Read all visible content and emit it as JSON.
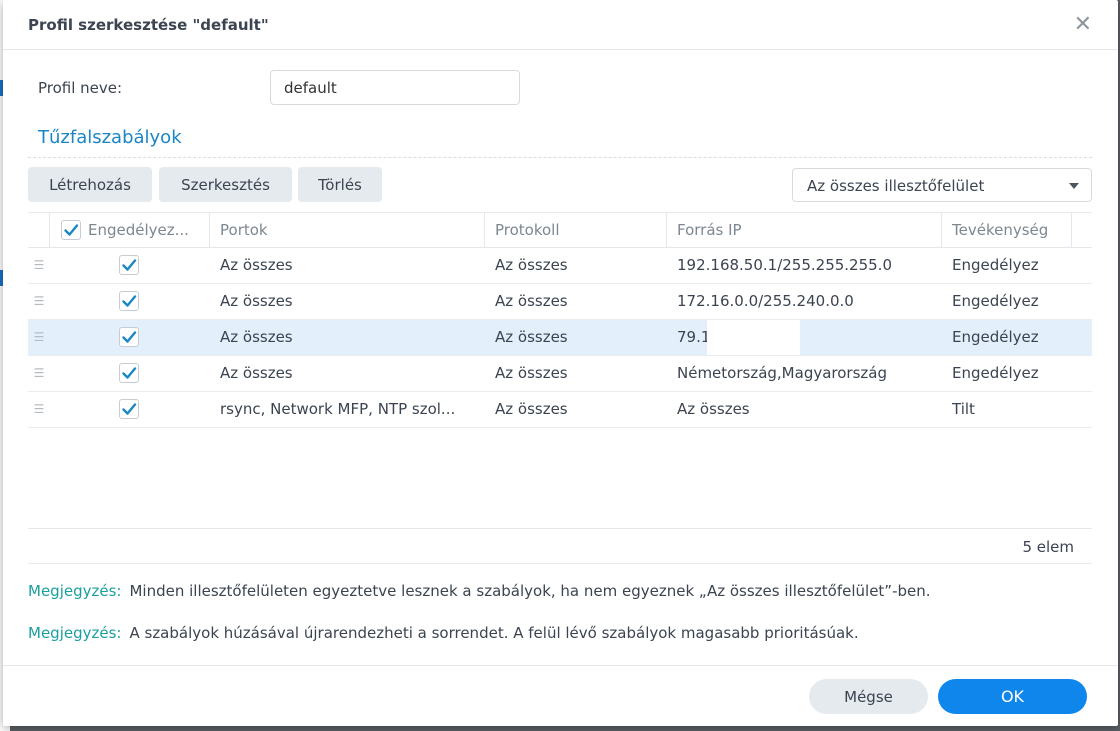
{
  "dialog": {
    "title": "Profil szerkesztése \"default\"",
    "close_icon": "close-icon"
  },
  "profile": {
    "label": "Profil neve:",
    "value": "default"
  },
  "rules_section": {
    "title": "Tűzfalszabályok"
  },
  "toolbar": {
    "create_label": "Létrehozás",
    "edit_label": "Szerkesztés",
    "delete_label": "Törlés",
    "interface_select": "Az összes illesztőfelület"
  },
  "table": {
    "headers": {
      "enable": "Engedélyez...",
      "ports": "Portok",
      "protocol": "Protokoll",
      "source_ip": "Forrás IP",
      "action": "Tevékenység"
    },
    "rows": [
      {
        "enabled": true,
        "ports": "Az összes",
        "protocol": "Az összes",
        "source_ip": "192.168.50.1/255.255.255.0",
        "action": "Engedélyez"
      },
      {
        "enabled": true,
        "ports": "Az összes",
        "protocol": "Az összes",
        "source_ip": "172.16.0.0/255.240.0.0",
        "action": "Engedélyez"
      },
      {
        "enabled": true,
        "ports": "Az összes",
        "protocol": "Az összes",
        "source_ip": "79.1",
        "action": "Engedélyez",
        "selected": true
      },
      {
        "enabled": true,
        "ports": "Az összes",
        "protocol": "Az összes",
        "source_ip": "Németország,Magyarország",
        "action": "Engedélyez"
      },
      {
        "enabled": true,
        "ports": "rsync, Network MFP, NTP szol...",
        "protocol": "Az összes",
        "source_ip": "Az összes",
        "action": "Tilt"
      }
    ],
    "count": "5 elem"
  },
  "notes": [
    {
      "key": "Megjegyzés:",
      "text": "Minden illesztőfelületen egyeztetve lesznek a szabályok, ha nem egyeznek „Az összes illesztőfelület”-ben."
    },
    {
      "key": "Megjegyzés:",
      "text": "A szabályok húzásával újrarendezheti a sorrendet. A felül lévő szabályok magasabb prioritásúak."
    }
  ],
  "footer": {
    "cancel_label": "Mégse",
    "ok_label": "OK"
  },
  "colors": {
    "accent": "#1b86c5",
    "primary_button": "#0f86ec",
    "note_key": "#1aa0a0",
    "selected_row": "#e3f0fb"
  }
}
